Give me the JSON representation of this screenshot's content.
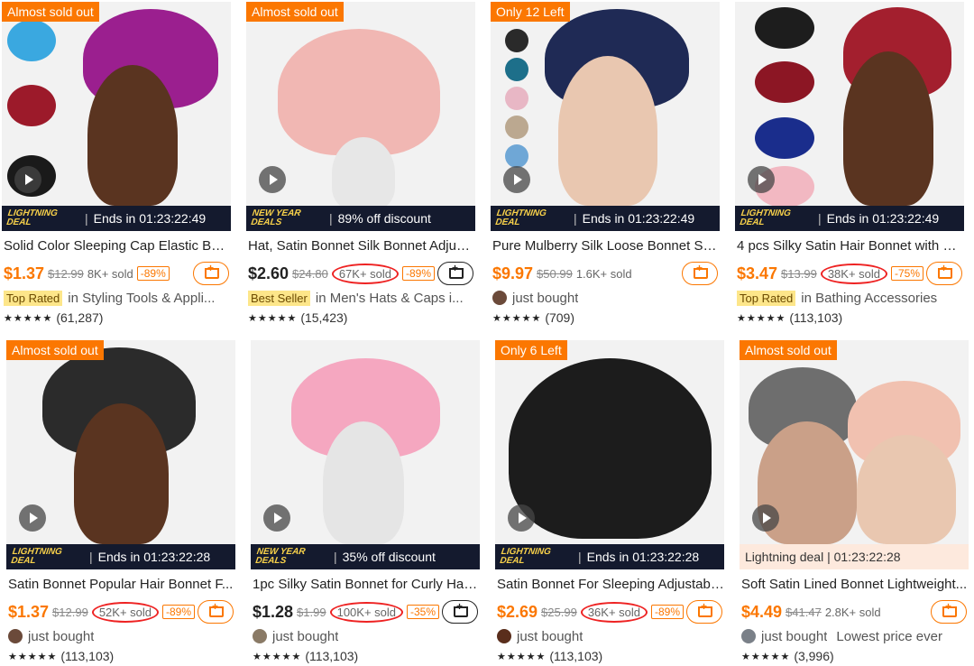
{
  "colors": {
    "accent": "#fb7701",
    "deal_strip": "#141a2e",
    "circle": "#ee2222"
  },
  "cards": [
    {
      "badge": "Almost sold out",
      "deal_logo": "LIGHTNING DEAL",
      "deal_text": "Ends in 01:23:22:49",
      "title": "Solid Color Sleeping Cap Elastic Ban...",
      "price": "$1.37",
      "orig": "$12.99",
      "sold": "8K+ sold",
      "discount": "-89%",
      "tag": "Top Rated",
      "meta": "in Styling Tools & Appli...",
      "stars": "★★★★★",
      "reviews": "(61,287)"
    },
    {
      "badge": "Almost sold out",
      "deal_logo": "NEW YEAR DEALS",
      "deal_text": "89% off discount",
      "title": "Hat, Satin Bonnet Silk Bonnet Adjust...",
      "price": "$2.60",
      "orig": "$24.80",
      "sold": "67K+ sold",
      "discount": "-89%",
      "tag": "Best Seller",
      "meta": "in Men's Hats & Caps i...",
      "stars": "★★★★★",
      "reviews": "(15,423)"
    },
    {
      "badge": "Only 12 Left",
      "deal_logo": "LIGHTNING DEAL",
      "deal_text": "Ends in 01:23:22:49",
      "title": "Pure Mulberry Silk Loose Bonnet So...",
      "price": "$9.97",
      "orig": "$50.99",
      "sold": "1.6K+ sold",
      "meta": "just bought",
      "stars": "★★★★★",
      "reviews": "(709)"
    },
    {
      "deal_logo": "LIGHTNING DEAL",
      "deal_text": "Ends in 01:23:22:49",
      "title": "4 pcs Silky Satin Hair Bonnet with W...",
      "price": "$3.47",
      "orig": "$13.99",
      "sold": "38K+ sold",
      "discount": "-75%",
      "tag": "Top Rated",
      "meta": "in Bathing Accessories",
      "stars": "★★★★★",
      "reviews": "(113,103)"
    },
    {
      "badge": "Almost sold out",
      "deal_logo": "LIGHTNING DEAL",
      "deal_text": "Ends in 01:23:22:28",
      "title": "Satin Bonnet Popular Hair Bonnet F...",
      "price": "$1.37",
      "orig": "$12.99",
      "sold": "52K+ sold",
      "discount": "-89%",
      "meta": "just bought",
      "stars": "★★★★★",
      "reviews": "(113,103)"
    },
    {
      "deal_logo": "NEW YEAR DEALS",
      "deal_text": "35% off discount",
      "title": "1pc Silky Satin Bonnet for Curly Hair...",
      "price": "$1.28",
      "orig": "$1.99",
      "sold": "100K+ sold",
      "discount": "-35%",
      "meta": "just bought",
      "stars": "★★★★★",
      "reviews": "(113,103)"
    },
    {
      "badge": "Only 6 Left",
      "deal_logo": "LIGHTNING DEAL",
      "deal_text": "Ends in 01:23:22:28",
      "title": "Satin Bonnet For Sleeping Adjustabl...",
      "price": "$2.69",
      "orig": "$25.99",
      "sold": "36K+ sold",
      "discount": "-89%",
      "meta": "just bought",
      "stars": "★★★★★",
      "reviews": "(113,103)"
    },
    {
      "badge": "Almost sold out",
      "deal_text": "Lightning deal | 01:23:22:28",
      "title": "Soft Satin Lined Bonnet Lightweight...",
      "price": "$4.49",
      "orig": "$41.47",
      "sold": "2.8K+ sold",
      "meta": "just bought",
      "extra": "Lowest price ever",
      "stars": "★★★★★",
      "reviews": "(3,996)"
    }
  ],
  "icons": [
    "play-icon",
    "cart-add-icon",
    "star-icon",
    "avatar"
  ]
}
